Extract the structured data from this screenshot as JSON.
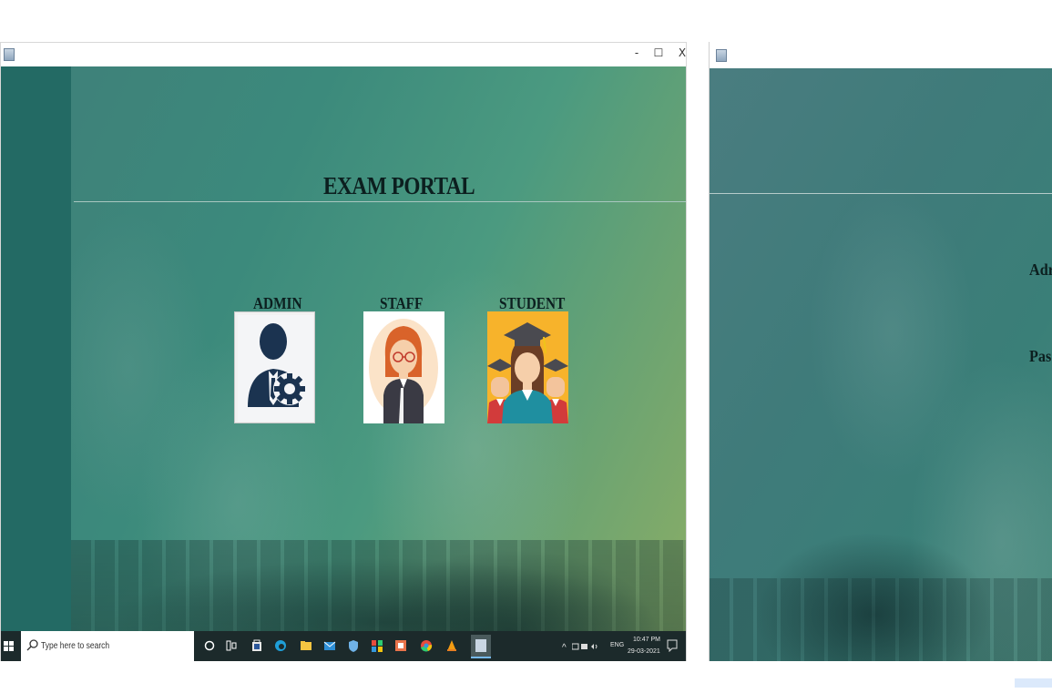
{
  "window_left": {
    "controls": {
      "minimize": "-",
      "maximize": "☐",
      "close": "X"
    },
    "title": "EXAM PORTAL",
    "roles": [
      {
        "label": "ADMIN"
      },
      {
        "label": "STAFF"
      },
      {
        "label": "STUDENT"
      }
    ]
  },
  "taskbar": {
    "search_placeholder": "Type here to search",
    "tray": {
      "language": "ENG",
      "time": "10:47 PM",
      "date": "29-03-2021"
    }
  },
  "window_right": {
    "labels": [
      "Adr",
      "Pas"
    ]
  },
  "colors": {
    "sidebar": "#236a64",
    "taskbar": "#1c2a2b",
    "title_text": "#0c1f1f"
  }
}
